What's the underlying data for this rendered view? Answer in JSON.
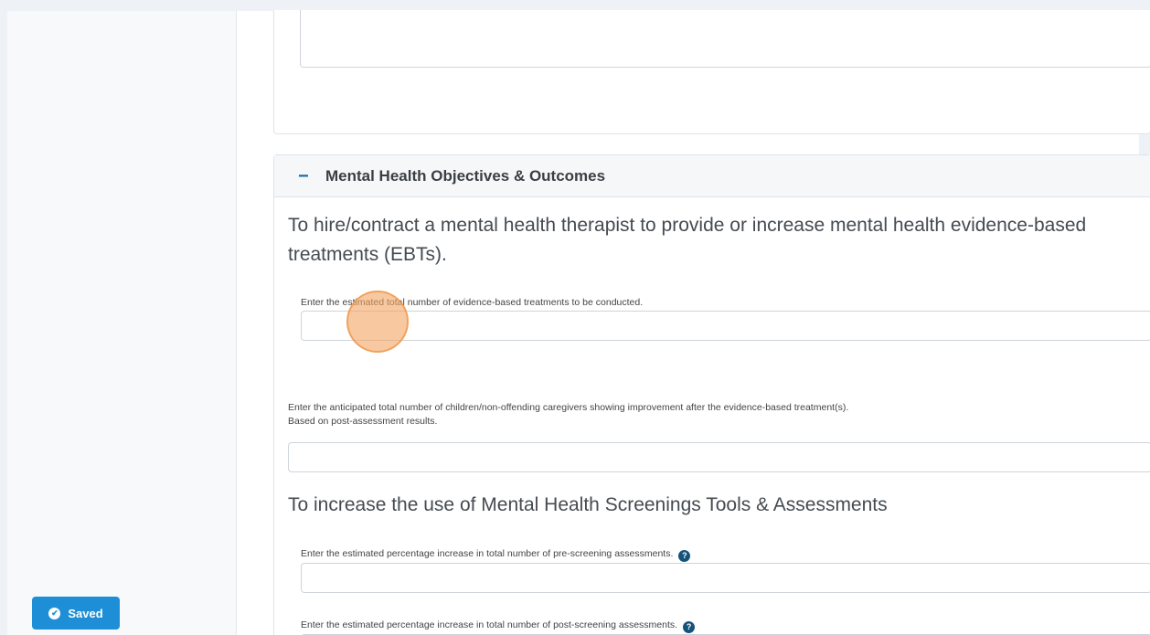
{
  "section": {
    "collapse_symbol": "−",
    "title": "Mental Health Objectives & Outcomes"
  },
  "objective1": {
    "heading_line1": "To hire/contract a mental health therapist to provide or increase mental health evidence-based",
    "heading_line2": "treatments (EBTs).",
    "field1_label": "Enter the estimated total number of evidence-based treatments to be conducted.",
    "field1_value": "",
    "field2_label_line1": "Enter the anticipated total number of children/non-offending caregivers showing improvement after the evidence-based treatment(s).",
    "field2_label_line2": "Based on post-assessment results.",
    "field2_value": ""
  },
  "objective2": {
    "heading": "To increase the use of Mental Health Screenings Tools & Assessments",
    "field1_label": "Enter the estimated percentage increase in total number of pre-screening assessments.",
    "field1_value": "",
    "field2_label": "Enter the estimated percentage increase in total number of post-screening assessments.",
    "field2_value": ""
  },
  "help_glyph": "?",
  "status": {
    "saved_label": "Saved",
    "check_glyph": "✔"
  },
  "colors": {
    "accent": "#1e8fd6",
    "help_icon": "#14537a",
    "click_marker": "#f4a460"
  }
}
